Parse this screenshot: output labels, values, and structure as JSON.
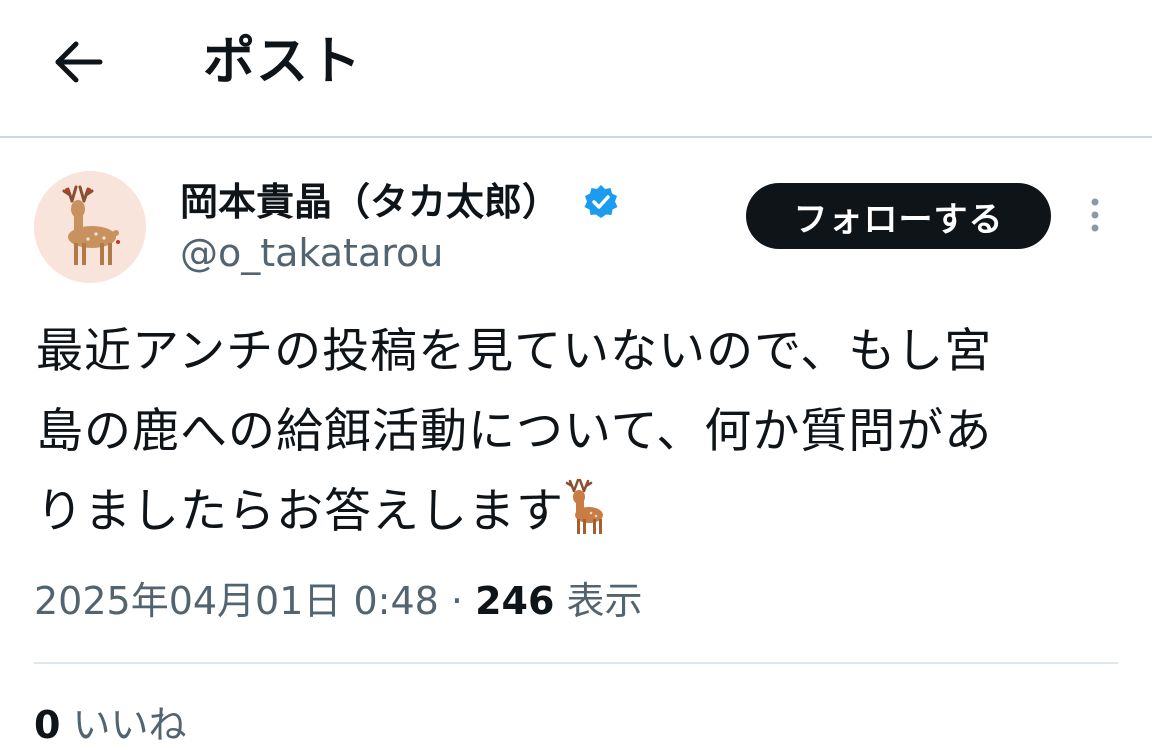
{
  "header": {
    "title": "ポスト",
    "back_icon": "arrow-left-icon"
  },
  "author": {
    "display_name": "岡本貴晶（タカ太郎）",
    "handle": "@o_takatarou",
    "verified_icon": "verified-badge-icon",
    "verified_color": "#1d9bf0",
    "avatar_icon": "deer-avatar"
  },
  "actions": {
    "follow_label": "フォローする",
    "more_icon": "more-vertical-icon"
  },
  "tweet": {
    "line1": "最近アンチの投稿を見ていないので、もし宮",
    "line2": "島の鹿への給餌活動について、何か質問があ",
    "line3": "りましたらお答えします",
    "emoji": "deer-emoji"
  },
  "meta": {
    "timestamp": "2025年04月01日 0:48",
    "separator": "·",
    "views_count": "246",
    "views_label": "表示"
  },
  "engagement": {
    "likes_count": "0",
    "likes_label": "いいね"
  },
  "colors": {
    "text_primary": "#0f1419",
    "text_secondary": "#536471",
    "divider": "#cfd9de",
    "button_bg": "#0f1419"
  }
}
